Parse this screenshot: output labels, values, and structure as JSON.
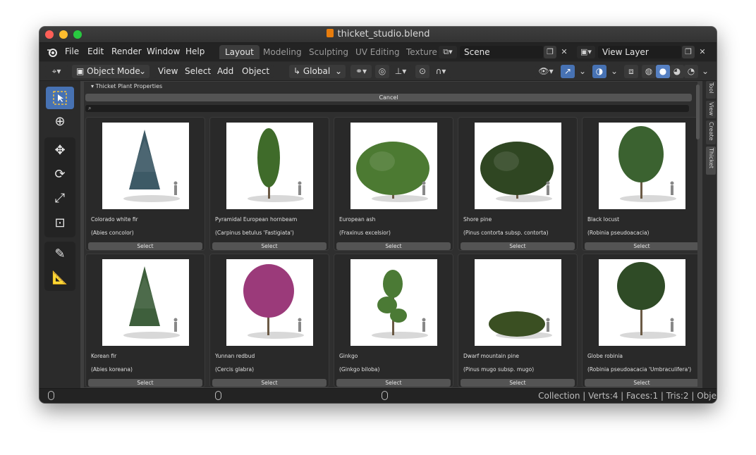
{
  "window": {
    "title": "thicket_studio.blend"
  },
  "menu": [
    "File",
    "Edit",
    "Render",
    "Window",
    "Help"
  ],
  "workspace_tabs": [
    {
      "label": "Layout",
      "active": true
    },
    {
      "label": "Modeling",
      "active": false
    },
    {
      "label": "Sculpting",
      "active": false
    },
    {
      "label": "UV Editing",
      "active": false
    },
    {
      "label": "Texture",
      "active": false
    }
  ],
  "scene": {
    "name": "Scene"
  },
  "view_layer": {
    "name": "View Layer"
  },
  "header": {
    "mode": "Object Mode",
    "menus": [
      "View",
      "Select",
      "Add",
      "Object"
    ],
    "transform_orientation": "Global"
  },
  "panel": {
    "title": "Thicket Plant Properties",
    "cancel_label": "Cancel",
    "search_placeholder": "",
    "select_label": "Select"
  },
  "plants": [
    {
      "name": "Colorado white fir",
      "latin": "(Abies concolor)",
      "shape": "conifer",
      "color": "#3d5a66"
    },
    {
      "name": "Pyramidal European hornbeam",
      "latin": "(Carpinus betulus 'Fastigiata')",
      "shape": "columnar",
      "color": "#3f6b2a"
    },
    {
      "name": "European ash",
      "latin": "(Fraxinus excelsior)",
      "shape": "round-wide",
      "color": "#4c7a32"
    },
    {
      "name": "Shore pine",
      "latin": "(Pinus contorta subsp. contorta)",
      "shape": "round-wide",
      "color": "#2f4622"
    },
    {
      "name": "Black locust",
      "latin": "(Robinia pseudoacacia)",
      "shape": "oval",
      "color": "#3b6230"
    },
    {
      "name": "Korean fir",
      "latin": "(Abies koreana)",
      "shape": "conifer",
      "color": "#3e5f3c"
    },
    {
      "name": "Yunnan redbud",
      "latin": "(Cercis glabra)",
      "shape": "shrub-tall",
      "color": "#9b3a7a"
    },
    {
      "name": "Ginkgo",
      "latin": "(Ginkgo biloba)",
      "shape": "sparse",
      "color": "#4b7a35"
    },
    {
      "name": "Dwarf mountain pine",
      "latin": "(Pinus mugo subsp. mugo)",
      "shape": "low-shrub",
      "color": "#3a4f22"
    },
    {
      "name": "Globe robinia",
      "latin": "(Robinia pseudoacacia 'Umbraculifera')",
      "shape": "globe",
      "color": "#2f4b26"
    }
  ],
  "side_tabs": [
    "Tool",
    "View",
    "Create",
    "Thicket"
  ],
  "status": {
    "text": "Collection | Verts:4 | Faces:1 | Tris:2 | Obje"
  }
}
